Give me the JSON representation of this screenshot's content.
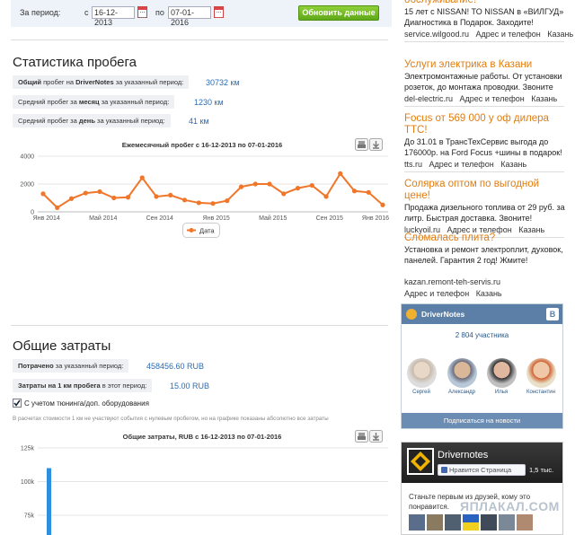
{
  "filter": {
    "period_label": "За период:",
    "from_label": "с",
    "from_value": "16-12-2013",
    "to_label": "по",
    "to_value": "07-01-2016",
    "update_button": "Обновить данные"
  },
  "mileage": {
    "title": "Статистика пробега",
    "total_label": "<b>Общий</b> пробег на <b>DriverNotes</b> за указанный период:",
    "total_value": "30732 км",
    "avg_month_label": "Средний пробег за <b>месяц</b> за указанный период:",
    "avg_month_value": "1230 км",
    "avg_day_label": "Средний пробег за <b>день</b> за указанный период:",
    "avg_day_value": "41 км"
  },
  "costs": {
    "title": "Общие затраты",
    "spent_label": "<b>Потрачено</b> за указанный период:",
    "spent_value": "458456.60 RUB",
    "per_km_label": "<b>Затраты на 1 км пробега</b> в этот период:",
    "per_km_value": "15.00 RUB",
    "tuning_checkbox_label": "С учетом тюнинга/доп. оборудования",
    "note": "В расчетах стоимости 1 км не участвуют события с нулевым пробегом, но на графике показаны абсолютно все затраты"
  },
  "colors": {
    "orange": "#f0762a",
    "blue": "#2e8fe0",
    "accent": "#e07d10"
  },
  "ads": [
    {
      "title": "обслуживание!",
      "text": "15 лет с NISSAN! TO NISSAN в «ВИЛГУД» Диагностика в Подарок. Заходите!",
      "domain": "service.wilgood.ru",
      "contacts": "Адрес и телефон",
      "city": "Казань"
    },
    {
      "title": "Услуги электрика в Казани",
      "text": "Электромонтажные работы. От установки розеток, до монтажа проводки. Звоните",
      "domain": "del-electric.ru",
      "contacts": "Адрес и телефон",
      "city": "Казань"
    },
    {
      "title": "Focus от 569 000 у оф дилера ТТС!",
      "text": "До 31.01 в ТрансТехСервис выгода до 176000р. на Ford Focus +шины в подарок!",
      "domain": "tts.ru",
      "contacts": "Адрес и телефон",
      "city": "Казань"
    },
    {
      "title": "Солярка оптом по выгодной цене!",
      "text": "Продажа дизельного топлива от 29 руб. за литр. Быстрая доставка. Звоните!",
      "domain": "luckyoil.ru",
      "contacts": "Адрес и телефон",
      "city": "Казань"
    },
    {
      "title": "Сломалась плита?",
      "text": "Установка и ремонт электроплит, духовок, панелей. Гарантия 2 год! Жмите!",
      "domain": "kazan.remont-teh-servis.ru",
      "contacts": "Адрес и телефон",
      "city": "Казань"
    }
  ],
  "vk": {
    "group": "DriverNotes",
    "badge": "В",
    "members": "2 804 участника",
    "people": [
      "Сергей",
      "Александр",
      "Илья",
      "Константин"
    ],
    "subscribe": "Подписаться на новости"
  },
  "fb": {
    "page": "Drivernotes",
    "like": "Нравится Страница",
    "count": "1,5 тыс.",
    "friends_text": "Станьте первым из друзей, кому это понравится."
  },
  "watermark": "ЯПЛАКАЛ.COM",
  "chart_data": [
    {
      "type": "line",
      "title": "Ежемесячный пробег с 16-12-2013 по 07-01-2016",
      "xlabel": "",
      "ylabel": "",
      "x_tick_labels": [
        "Янв 2014",
        "Май 2014",
        "Сен 2014",
        "Янв 2015",
        "Май 2015",
        "Сен 2015",
        "Янв 2016"
      ],
      "y_ticks": [
        0,
        2000,
        4000
      ],
      "ylim": [
        0,
        4000
      ],
      "series": [
        {
          "name": "Дата",
          "values": [
            1300,
            300,
            950,
            1350,
            1450,
            1000,
            1050,
            2450,
            1100,
            1200,
            850,
            650,
            600,
            800,
            1800,
            2000,
            2000,
            1300,
            1700,
            1900,
            1100,
            2750,
            1500,
            1400,
            500
          ]
        }
      ],
      "grid": true,
      "legend": "bottom-center"
    },
    {
      "type": "bar",
      "title": "Общие затраты, RUB с 16-12-2013 по 07-01-2016",
      "y_ticks": [
        "75k",
        "100k",
        "125k"
      ],
      "ylim": [
        60000,
        125000
      ],
      "values": [
        110000
      ],
      "grid": true
    }
  ]
}
